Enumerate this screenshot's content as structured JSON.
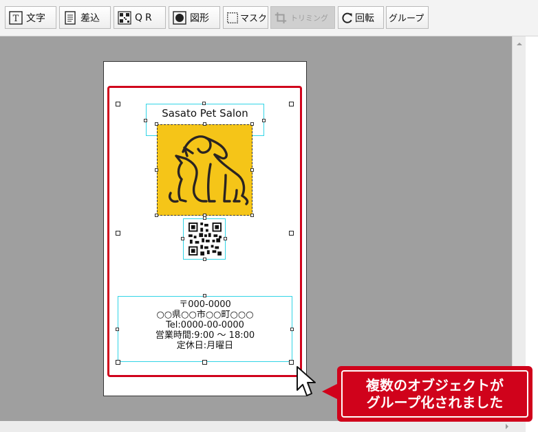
{
  "toolbar": {
    "text_label": "文字",
    "insert_label": "差込",
    "qr_label": "QR",
    "shape_label": "図形",
    "mask_label": "マスク",
    "trim_label": "トリミング",
    "rotate_label": "回転",
    "group_label": "グループ"
  },
  "card": {
    "salon_name": "Sasato Pet Salon",
    "postal": "〒000-0000",
    "address": "○○県○○市○○町○○○",
    "tel": "Tel:0000-00-0000",
    "hours": "営業時間:9:00 〜 18:00",
    "holiday": "定休日:月曜日"
  },
  "callout": {
    "line1": "複数のオブジェクトが",
    "line2": "グループ化されました"
  },
  "colors": {
    "highlight": "#d0021b",
    "logo_bg": "#f5c518",
    "selection": "#30d4e6",
    "canvas_bg": "#9f9f9f"
  },
  "icons": [
    "text-box-icon",
    "insert-doc-icon",
    "qr-code-icon",
    "shape-icon",
    "mask-icon",
    "crop-icon",
    "rotate-icon",
    "mouse-cursor-icon",
    "pet-logo-icon"
  ]
}
